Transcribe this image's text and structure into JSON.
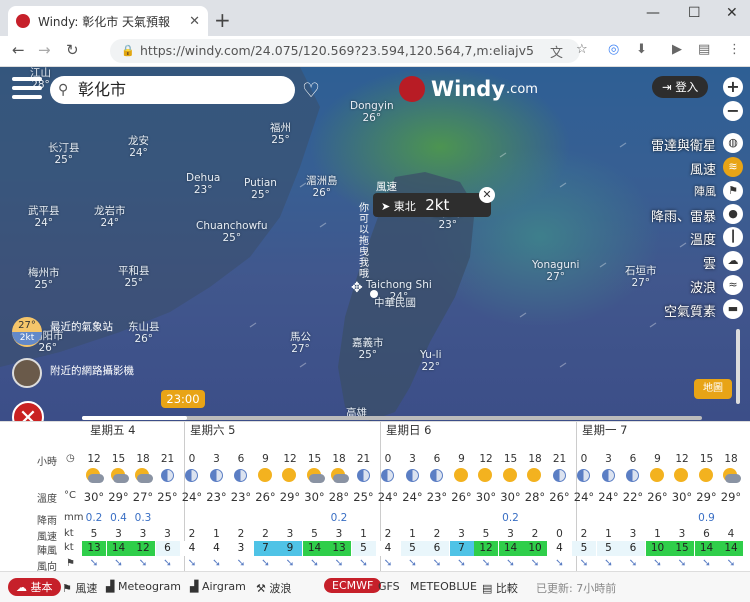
{
  "browser": {
    "tab_title": "Windy: 彰化市 天氣預報",
    "url": "https://windy.com/24.075/120.569?23.594,120.564,7,m:eliajv5"
  },
  "map": {
    "search_value": "彰化市",
    "logo_text": "Windy",
    "logo_suffix": ".com",
    "login_label": "登入",
    "layers": [
      {
        "label": "雷達與衛星",
        "icon": "globe-icon",
        "active": false
      },
      {
        "label": "風速",
        "icon": "wind-icon",
        "active": true
      },
      {
        "label": "陣風",
        "icon": "flag-icon",
        "active": false
      },
      {
        "label": "降雨、雷暴",
        "icon": "drop-icon",
        "active": false
      },
      {
        "label": "溫度",
        "icon": "thermometer-icon",
        "active": false
      },
      {
        "label": "雲",
        "icon": "cloud-icon",
        "active": false
      },
      {
        "label": "波浪",
        "icon": "wave-icon",
        "active": false
      },
      {
        "label": "空氣質素",
        "icon": "car-icon",
        "active": false
      }
    ],
    "legend_button": "地圖",
    "popup": {
      "wind_label": "風速",
      "direction": "東北",
      "speed": "2kt",
      "vertical_label": "你可以拖曳我哦"
    },
    "station": {
      "temp": "27°",
      "wind": "2kt",
      "label": "最近的氣象站"
    },
    "webcam_label": "附近的網路攝影機",
    "time_chip": "23:00",
    "timeline_progress": 0.17,
    "cities": [
      {
        "name": "江山",
        "temp": "28°"
      },
      {
        "name": "长汀县",
        "temp": "25°"
      },
      {
        "name": "龙安",
        "temp": "24°"
      },
      {
        "name": "福州",
        "temp": "25°"
      },
      {
        "name": "Dongyin",
        "temp": "26°"
      },
      {
        "name": "Dehua",
        "temp": "23°"
      },
      {
        "name": "Putian",
        "temp": "25°"
      },
      {
        "name": "湄洲島",
        "temp": "26°"
      },
      {
        "name": "武平县",
        "temp": "24°"
      },
      {
        "name": "龙岩市",
        "temp": "24°"
      },
      {
        "name": "Chuanchowfu",
        "temp": "25°"
      },
      {
        "name": "梅州市",
        "temp": "25°"
      },
      {
        "name": "平和县",
        "temp": "25°"
      },
      {
        "name": "揭阳市",
        "temp": "26°"
      },
      {
        "name": "东山县",
        "temp": "26°"
      },
      {
        "name": "馬公",
        "temp": "27°"
      },
      {
        "name": "基隆市",
        "temp": "23°"
      },
      {
        "name": "Taichong Shi",
        "temp": "24°"
      },
      {
        "name": "嘉義市",
        "temp": "25°"
      },
      {
        "name": "Yu-li",
        "temp": "22°"
      },
      {
        "name": "Yonaguni",
        "temp": "27°"
      },
      {
        "name": "石垣市",
        "temp": "27°"
      },
      {
        "name": "高雄",
        "temp": ""
      },
      {
        "name": "中華民國",
        "temp": ""
      }
    ]
  },
  "forecast": {
    "days": [
      "星期五 4",
      "星期六 5",
      "星期日 6",
      "星期一 7"
    ],
    "row_labels": {
      "hours": "小時",
      "temp": "溫度",
      "temp_unit": "°C",
      "rain": "降雨",
      "rain_unit": "mm",
      "wind": "風速",
      "wind_unit": "kt",
      "gust": "陣風",
      "gust_unit": "kt",
      "dir": "風向"
    },
    "hours": [
      "12",
      "15",
      "18",
      "21",
      "0",
      "3",
      "6",
      "9",
      "12",
      "15",
      "18",
      "21",
      "0",
      "3",
      "6",
      "9",
      "12",
      "15",
      "18",
      "21",
      "0",
      "3",
      "6",
      "9",
      "12",
      "15",
      "18"
    ],
    "icons": [
      "cloud",
      "cloud",
      "cloud",
      "moon",
      "moon",
      "moon",
      "moon",
      "sun",
      "sun",
      "cloud",
      "cloud",
      "moon",
      "moon",
      "moon",
      "moon",
      "sun",
      "sun",
      "sun",
      "sun",
      "moon",
      "moon",
      "moon",
      "moon",
      "sun",
      "sun",
      "sun",
      "cloud"
    ],
    "temps": [
      "30°",
      "29°",
      "27°",
      "25°",
      "24°",
      "23°",
      "23°",
      "26°",
      "29°",
      "30°",
      "28°",
      "25°",
      "24°",
      "24°",
      "23°",
      "26°",
      "30°",
      "30°",
      "28°",
      "26°",
      "24°",
      "24°",
      "22°",
      "26°",
      "30°",
      "29°",
      "29°"
    ],
    "rain": [
      "0.2",
      "0.4",
      "0.3",
      "",
      "",
      "",
      "",
      "",
      "",
      "",
      "0.2",
      "",
      "",
      "",
      "",
      "",
      "",
      "0.2",
      "",
      "",
      "",
      "",
      "",
      "",
      "",
      "0.9",
      ""
    ],
    "wind": [
      "5",
      "3",
      "3",
      "3",
      "2",
      "1",
      "2",
      "2",
      "3",
      "5",
      "3",
      "1",
      "2",
      "1",
      "2",
      "3",
      "5",
      "3",
      "2",
      "0",
      "2",
      "1",
      "3",
      "1",
      "3",
      "6",
      "4"
    ],
    "gust": [
      "13",
      "14",
      "12",
      "6",
      "4",
      "4",
      "3",
      "7",
      "9",
      "14",
      "13",
      "5",
      "4",
      "5",
      "6",
      "7",
      "12",
      "14",
      "10",
      "4",
      "5",
      "5",
      "6",
      "10",
      "15",
      "14",
      "14"
    ],
    "gust_levels": [
      3,
      3,
      3,
      1,
      0,
      0,
      0,
      2,
      2,
      3,
      3,
      1,
      0,
      1,
      1,
      2,
      3,
      3,
      3,
      0,
      1,
      1,
      1,
      3,
      3,
      3,
      3
    ]
  },
  "bottom": {
    "items": [
      "基本",
      "風速",
      "Meteogram",
      "Airgram",
      "波浪",
      "ECMWF",
      "GFS",
      "METEOBLUE",
      "比較"
    ],
    "updated": "已更新: 7小時前"
  },
  "colors": {
    "accent": "#e8a416",
    "brand": "#c6202a",
    "gust_low": "#4fc3e6",
    "gust_high": "#2fce4a"
  }
}
